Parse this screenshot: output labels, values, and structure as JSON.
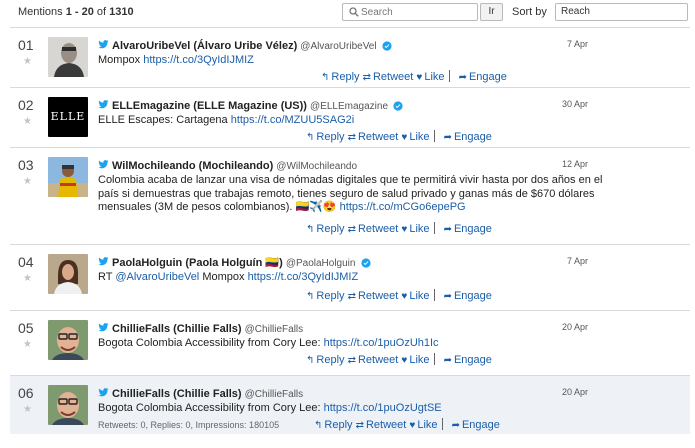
{
  "header": {
    "mentions_prefix": "Mentions",
    "range": "1 - 20",
    "of": "of",
    "total": "1310",
    "search_placeholder": "Search",
    "go_label": "Ir",
    "sort_label": "Sort by",
    "sort_value": "Reach"
  },
  "actions": {
    "reply": "Reply",
    "retweet": "Retweet",
    "like": "Like",
    "engage": "Engage"
  },
  "colors": {
    "link": "#1a5ea8",
    "twitter": "#1da1f2",
    "highlight_row": "#eef2f7"
  },
  "mentions": [
    {
      "index": "01",
      "name": "AlvaroUribeVel (Álvaro Uribe Vélez)",
      "handle": "@AlvaroUribeVel",
      "date": "7 Apr",
      "text": "Mompox ",
      "link": "https://t.co/3QyIdIJMIZ",
      "text_after": "",
      "meta": ""
    },
    {
      "index": "02",
      "name": "ELLEmagazine (ELLE Magazine (US))",
      "handle": "@ELLEmagazine",
      "date": "30 Apr",
      "text": "ELLE Escapes: Cartagena ",
      "link": "https://t.co/MZUU5SAG2i",
      "text_after": "",
      "meta": "",
      "avatar_text": "ELLE"
    },
    {
      "index": "03",
      "name": "WilMochileando (Mochileando)",
      "handle": "@WilMochileando",
      "date": "12 Apr",
      "text": "Colombia acaba de lanzar una visa de nómadas digitales que te permitirá vivir hasta por dos años en el país si demuestras que trabajas remoto, tienes seguro de salud privado y ganas más de $670 dólares mensuales (3M de pesos colombianos). 🇨🇴✈️😍 ",
      "link": "https://t.co/mCGo6epePG",
      "text_after": "",
      "meta": ""
    },
    {
      "index": "04",
      "name": "PaolaHolguin (Paola Holguín 🇨🇴)",
      "handle": "@PaolaHolguin",
      "date": "7 Apr",
      "text": "RT ",
      "mention": "@AlvaroUribeVel",
      "text_mid": " Mompox ",
      "link": "https://t.co/3QyIdIJMIZ",
      "meta": ""
    },
    {
      "index": "05",
      "name": "ChillieFalls (Chillie Falls)",
      "handle": "@ChillieFalls",
      "date": "20 Apr",
      "text": "Bogota Colombia Accessibility from Cory Lee: ",
      "link": "https://t.co/1puOzUh1Ic",
      "text_after": "",
      "meta": ""
    },
    {
      "index": "06",
      "name": "ChillieFalls (Chillie Falls)",
      "handle": "@ChillieFalls",
      "date": "20 Apr",
      "text": "Bogota Colombia Accessibility from Cory Lee: ",
      "link": "https://t.co/1puOzUgtSE",
      "text_after": "",
      "meta": "Retweets: 0, Replies: 0, Impressions: 180105"
    }
  ]
}
